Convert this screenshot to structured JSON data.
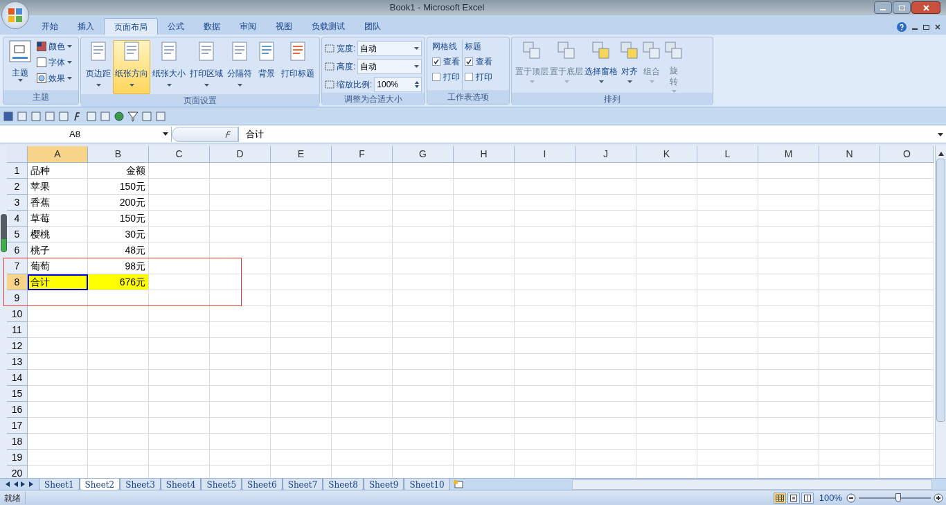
{
  "window": {
    "title": "Book1 - Microsoft Excel"
  },
  "tabs": [
    {
      "label": "开始",
      "selected": false
    },
    {
      "label": "插入",
      "selected": false
    },
    {
      "label": "页面布局",
      "selected": true
    },
    {
      "label": "公式",
      "selected": false
    },
    {
      "label": "数据",
      "selected": false
    },
    {
      "label": "审阅",
      "selected": false
    },
    {
      "label": "视图",
      "selected": false
    },
    {
      "label": "负载测试",
      "selected": false
    },
    {
      "label": "团队",
      "selected": false
    }
  ],
  "ribbon": {
    "themes": {
      "label": "主题",
      "main": "主题",
      "options": [
        "颜色",
        "字体",
        "效果"
      ]
    },
    "page_setup": {
      "label": "页面设置",
      "buttons": [
        {
          "label": "页边距",
          "selected": false
        },
        {
          "label": "纸张方向",
          "selected": true
        },
        {
          "label": "纸张大小",
          "selected": false
        },
        {
          "label": "打印区域",
          "selected": false
        },
        {
          "label": "分隔符",
          "selected": false
        },
        {
          "label": "背景",
          "selected": false
        },
        {
          "label": "打印标题",
          "selected": false
        }
      ]
    },
    "scale_to_fit": {
      "label": "调整为合适大小",
      "fields": [
        {
          "label": "宽度:",
          "value": "自动",
          "kind": "dropdown"
        },
        {
          "label": "高度:",
          "value": "自动",
          "kind": "dropdown"
        },
        {
          "label": "缩放比例:",
          "value": "100%",
          "kind": "spinner"
        }
      ]
    },
    "sheet_options": {
      "label": "工作表选项",
      "sections": [
        {
          "title": "网格线",
          "options": [
            {
              "label": "查看",
              "checked": true
            },
            {
              "label": "打印",
              "checked": false
            }
          ]
        },
        {
          "title": "标题",
          "options": [
            {
              "label": "查看",
              "checked": true
            },
            {
              "label": "打印",
              "checked": false
            }
          ]
        }
      ]
    },
    "arrange": {
      "label": "排列",
      "buttons": [
        {
          "label": "置于顶层",
          "disabled": true
        },
        {
          "label": "置于底层",
          "disabled": true
        },
        {
          "label": "选择窗格",
          "disabled": false
        },
        {
          "label": "对齐",
          "disabled": false
        },
        {
          "label": "组合",
          "disabled": true
        },
        {
          "label": "旋转",
          "disabled": true
        }
      ]
    }
  },
  "formula_bar": {
    "name_box": "A8",
    "formula": "合计"
  },
  "sheet": {
    "columns": [
      {
        "label": "A",
        "selected": true
      },
      {
        "label": "B",
        "selected": false
      },
      {
        "label": "C",
        "selected": false
      },
      {
        "label": "D",
        "selected": false
      },
      {
        "label": "E",
        "selected": false
      },
      {
        "label": "F",
        "selected": false
      },
      {
        "label": "G",
        "selected": false
      },
      {
        "label": "H",
        "selected": false
      },
      {
        "label": "I",
        "selected": false
      },
      {
        "label": "J",
        "selected": false
      },
      {
        "label": "K",
        "selected": false
      },
      {
        "label": "L",
        "selected": false
      },
      {
        "label": "M",
        "selected": false
      },
      {
        "label": "N",
        "selected": false
      },
      {
        "label": "O",
        "selected": false
      }
    ],
    "rows": [
      {
        "label": "1",
        "selected": false,
        "cells": [
          {
            "text": "品种",
            "highlighted": false,
            "active": false
          },
          {
            "text": "金额",
            "highlighted": false,
            "active": false
          }
        ]
      },
      {
        "label": "2",
        "selected": false,
        "cells": [
          {
            "text": "苹果",
            "highlighted": false,
            "active": false
          },
          {
            "text": "150元",
            "highlighted": false,
            "active": false
          }
        ]
      },
      {
        "label": "3",
        "selected": false,
        "cells": [
          {
            "text": "香蕉",
            "highlighted": false,
            "active": false
          },
          {
            "text": "200元",
            "highlighted": false,
            "active": false
          }
        ]
      },
      {
        "label": "4",
        "selected": false,
        "cells": [
          {
            "text": "草莓",
            "highlighted": false,
            "active": false
          },
          {
            "text": "150元",
            "highlighted": false,
            "active": false
          }
        ]
      },
      {
        "label": "5",
        "selected": false,
        "cells": [
          {
            "text": "樱桃",
            "highlighted": false,
            "active": false
          },
          {
            "text": "30元",
            "highlighted": false,
            "active": false
          }
        ]
      },
      {
        "label": "6",
        "selected": false,
        "cells": [
          {
            "text": "桃子",
            "highlighted": false,
            "active": false
          },
          {
            "text": "48元",
            "highlighted": false,
            "active": false
          }
        ]
      },
      {
        "label": "7",
        "selected": false,
        "cells": [
          {
            "text": "葡萄",
            "highlighted": false,
            "active": false
          },
          {
            "text": "98元",
            "highlighted": false,
            "active": false
          }
        ]
      },
      {
        "label": "8",
        "selected": true,
        "cells": [
          {
            "text": "合计",
            "highlighted": true,
            "active": true
          },
          {
            "text": "676元",
            "highlighted": true,
            "active": false
          }
        ]
      },
      {
        "label": "9",
        "selected": false,
        "cells": []
      },
      {
        "label": "10",
        "selected": false,
        "cells": []
      },
      {
        "label": "11",
        "selected": false,
        "cells": []
      },
      {
        "label": "12",
        "selected": false,
        "cells": []
      },
      {
        "label": "13",
        "selected": false,
        "cells": []
      },
      {
        "label": "14",
        "selected": false,
        "cells": []
      },
      {
        "label": "15",
        "selected": false,
        "cells": []
      },
      {
        "label": "16",
        "selected": false,
        "cells": []
      },
      {
        "label": "17",
        "selected": false,
        "cells": []
      },
      {
        "label": "18",
        "selected": false,
        "cells": []
      },
      {
        "label": "19",
        "selected": false,
        "cells": []
      },
      {
        "label": "20",
        "selected": false,
        "cells": []
      }
    ]
  },
  "sheet_tabs": [
    {
      "label": "Sheet1",
      "selected": false
    },
    {
      "label": "Sheet2",
      "selected": true
    },
    {
      "label": "Sheet3",
      "selected": false
    },
    {
      "label": "Sheet4",
      "selected": false
    },
    {
      "label": "Sheet5",
      "selected": false
    },
    {
      "label": "Sheet6",
      "selected": false
    },
    {
      "label": "Sheet7",
      "selected": false
    },
    {
      "label": "Sheet8",
      "selected": false
    },
    {
      "label": "Sheet9",
      "selected": false
    },
    {
      "label": "Sheet10",
      "selected": false
    }
  ],
  "status_bar": {
    "text": "就绪",
    "views": [
      {
        "kind": "normal",
        "selected": true
      },
      {
        "kind": "page_layout",
        "selected": false
      },
      {
        "kind": "page_break",
        "selected": false
      }
    ],
    "zoom": "100%",
    "level": 0.55
  }
}
